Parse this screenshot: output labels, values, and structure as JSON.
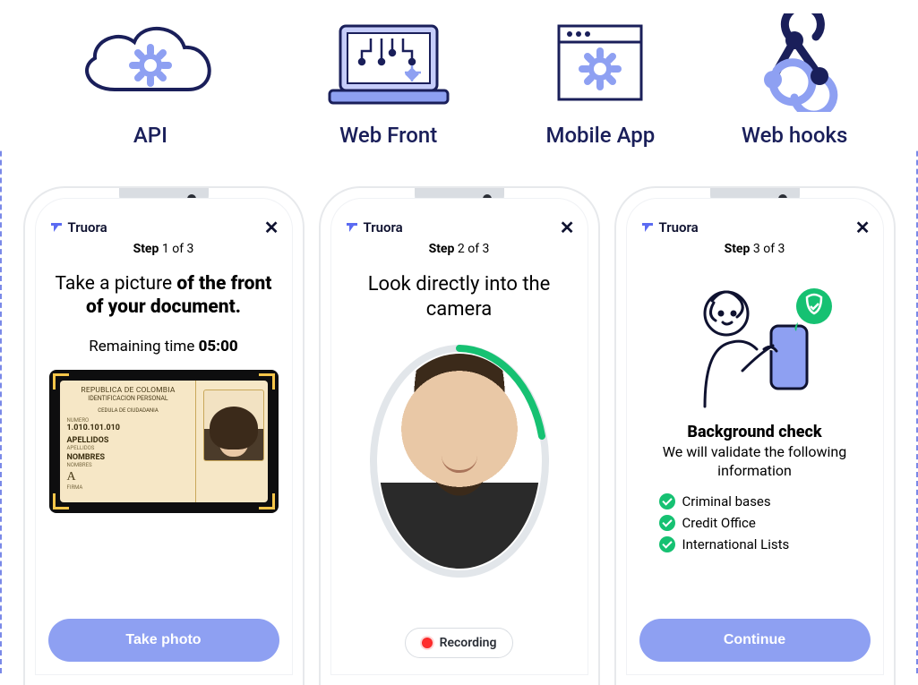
{
  "integrations": [
    {
      "label": "API",
      "icon": "cloud-gear"
    },
    {
      "label": "Web Front",
      "icon": "laptop-circuit"
    },
    {
      "label": "Mobile App",
      "icon": "window-gear"
    },
    {
      "label": "Web hooks",
      "icon": "webhook"
    }
  ],
  "brand": "Truora",
  "phones": {
    "p1": {
      "step_prefix": "Step",
      "step_num": "1",
      "step_of": "of 3",
      "headline_plain": "Take a picture ",
      "headline_bold": "of the front of your document.",
      "remaining_label": "Remaining time ",
      "remaining_value": "05:00",
      "id": {
        "country": "REPUBLICA DE COLOMBIA",
        "doc": "IDENTIFICACION PERSONAL",
        "sub": "CEDULA DE CIUDADANIA",
        "num_label": "NUMERO",
        "num": "1.010.101.010",
        "ap_label": "APELLIDOS",
        "ap": "APELLIDOS",
        "nom_label": "NOMBRES",
        "nom": "NOMBRES",
        "firma_label": "FIRMA"
      },
      "cta": "Take photo"
    },
    "p2": {
      "step_prefix": "Step",
      "step_num": "2",
      "step_of": "of 3",
      "headline": "Look directly into the camera",
      "recording": "Recording"
    },
    "p3": {
      "step_prefix": "Step",
      "step_num": "3",
      "step_of": "of 3",
      "bg_title": "Background check",
      "bg_sub": "We will validate the following information",
      "checks": [
        "Criminal bases",
        "Credit Office",
        "International Lists"
      ],
      "cta": "Continue"
    }
  },
  "colors": {
    "accent": "#8ea0f2",
    "success": "#16c172",
    "dark": "#1a1f5a"
  }
}
